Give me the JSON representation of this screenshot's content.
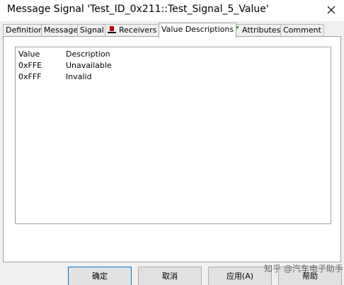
{
  "window": {
    "title": "Message Signal 'Test_ID_0x211::Test_Signal_5_Value'"
  },
  "tabs": [
    {
      "label": "Definition"
    },
    {
      "label": "Message"
    },
    {
      "label": "Signal"
    },
    {
      "label": "Receivers",
      "icon": "receivers-icon"
    },
    {
      "label": "Value Descriptions",
      "active": true
    },
    {
      "label": "Attributes",
      "icon": "attributes-icon"
    },
    {
      "label": "Comment"
    }
  ],
  "value_table": {
    "columns": [
      "Value",
      "Description"
    ],
    "rows": [
      {
        "value": "0xFFE",
        "description": "Unavailable"
      },
      {
        "value": "0xFFF",
        "description": "Invalid"
      }
    ]
  },
  "buttons": {
    "ok": "确定",
    "cancel": "取消",
    "apply": "应用(A)",
    "help": "帮助"
  },
  "watermark": "知乎 @汽车电子助手",
  "colors": {
    "dialog_bg": "#f0f0f0",
    "default_button_border": "#0078d7",
    "receivers_icon": "#c00000",
    "attributes_icon": "#3a8a2a"
  }
}
